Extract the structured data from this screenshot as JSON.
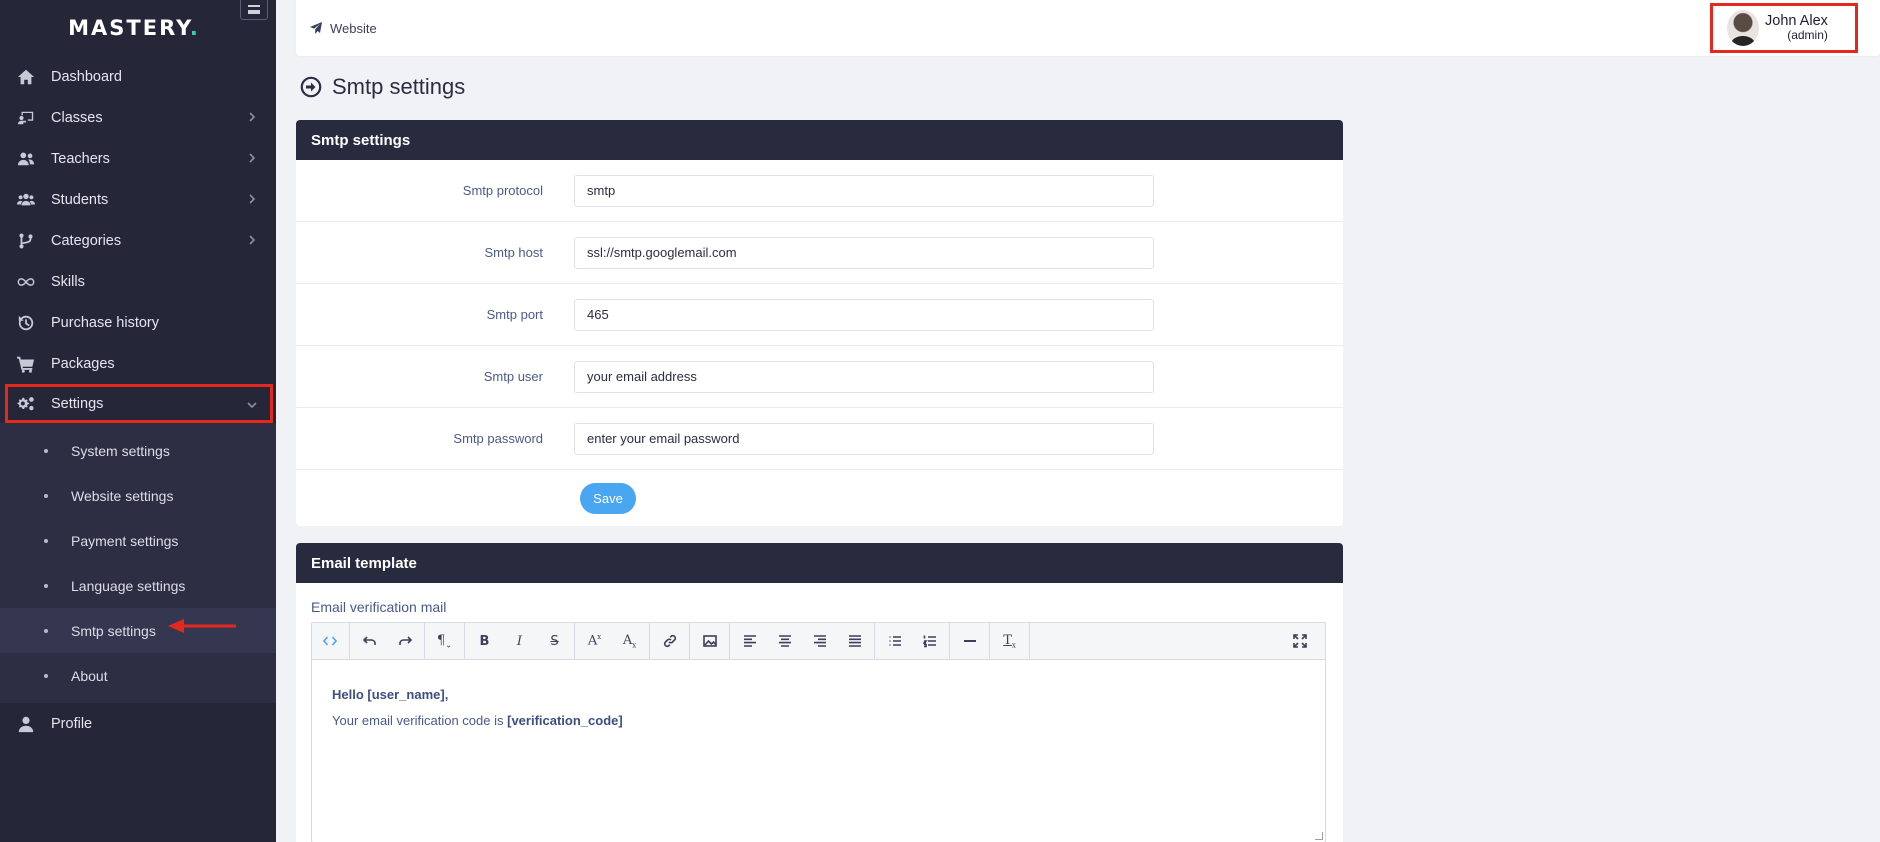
{
  "brand": {
    "name": "MASTERY",
    "dot": "."
  },
  "sidebar": {
    "items": [
      {
        "label": "Dashboard",
        "icon": "home-icon"
      },
      {
        "label": "Classes",
        "icon": "chalkboard-teacher-icon"
      },
      {
        "label": "Teachers",
        "icon": "users-icon"
      },
      {
        "label": "Students",
        "icon": "user-group-icon"
      },
      {
        "label": "Categories",
        "icon": "code-branch-icon"
      },
      {
        "label": "Skills",
        "icon": "infinity-icon"
      },
      {
        "label": "Purchase history",
        "icon": "history-icon"
      },
      {
        "label": "Packages",
        "icon": "shopping-cart-icon"
      },
      {
        "label": "Settings",
        "icon": "cogs-icon"
      },
      {
        "label": "Profile",
        "icon": "user-icon"
      }
    ],
    "settings_sub": [
      "System settings",
      "Website settings",
      "Payment settings",
      "Language settings",
      "Smtp settings",
      "About"
    ]
  },
  "topbar": {
    "website_label": "Website",
    "user_name": "John Alex",
    "user_role": "(admin)"
  },
  "page": {
    "title": "Smtp settings"
  },
  "smtp_card": {
    "title": "Smtp settings",
    "fields": [
      {
        "label": "Smtp protocol",
        "value": "smtp"
      },
      {
        "label": "Smtp host",
        "value": "ssl://smtp.googlemail.com"
      },
      {
        "label": "Smtp port",
        "value": "465"
      },
      {
        "label": "Smtp user",
        "value": "your email address"
      },
      {
        "label": "Smtp password",
        "value": "enter your email password"
      }
    ],
    "save_label": "Save"
  },
  "email_card": {
    "title": "Email template",
    "template_label": "Email verification mail",
    "body_line1": "Hello [user_name],",
    "body_line2_prefix": "Your email verification code is ",
    "body_line2_code": "[verification_code]"
  },
  "colors": {
    "sidebar_bg": "#252638",
    "card_header_bg": "#282a3d",
    "accent_blue": "#48a7f0",
    "highlight_red": "#e5281e",
    "brand_dot": "#2fd3a6"
  }
}
